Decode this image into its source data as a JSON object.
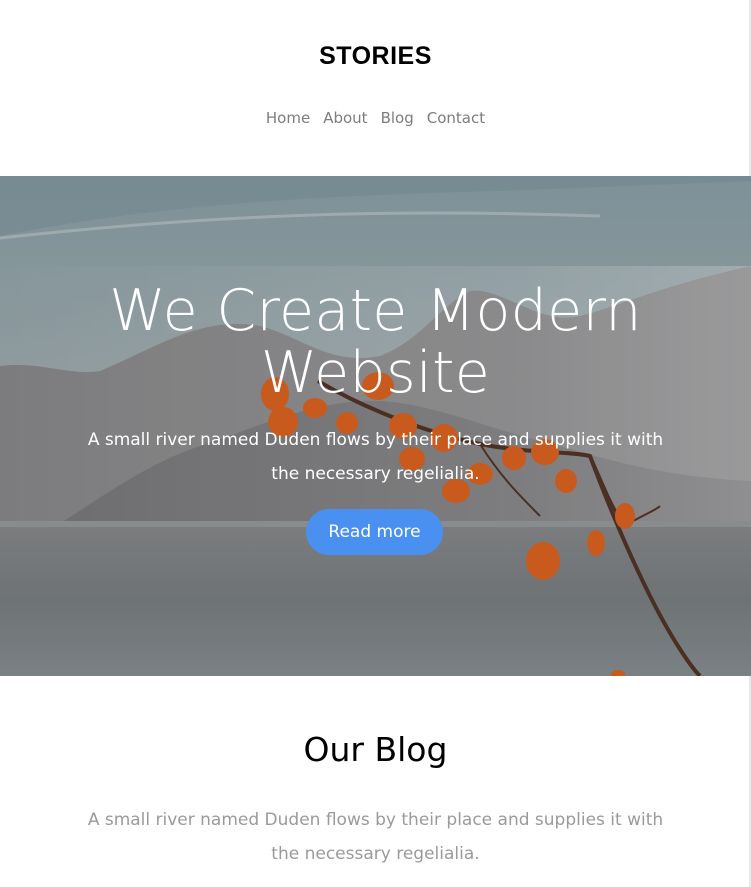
{
  "brand": {
    "name": "STORIES"
  },
  "nav": {
    "items": [
      {
        "label": "Home"
      },
      {
        "label": "About"
      },
      {
        "label": "Blog"
      },
      {
        "label": "Contact"
      }
    ]
  },
  "hero": {
    "title_line1": "We Create Modern",
    "title_line2": "Website",
    "subtitle": "A small river named Duden flows by their place and supplies it with the necessary regelialia.",
    "button_label": "Read more",
    "button_color": "#4a90f0"
  },
  "blog": {
    "title": "Our Blog",
    "subtitle": "A small river named Duden flows by their place and supplies it with the necessary regelialia."
  },
  "colors": {
    "nav_text": "#7d7d7d",
    "muted_text": "#9a9a9a",
    "leaf": "#c85a1e"
  }
}
